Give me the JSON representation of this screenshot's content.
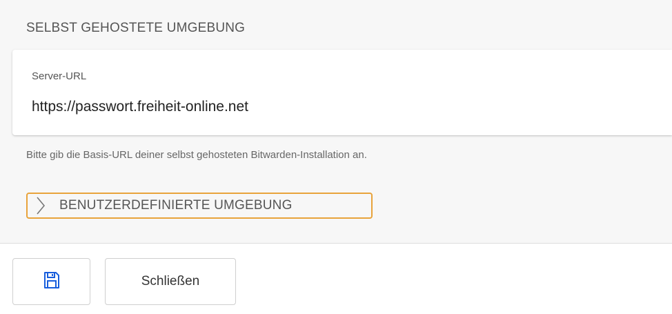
{
  "section": {
    "title": "SELBST GEHOSTETE UMGEBUNG"
  },
  "server_url": {
    "label": "Server-URL",
    "value": "https://passwort.freiheit-online.net"
  },
  "help_text": "Bitte gib die Basis-URL deiner selbst gehosteten Bitwarden-Installation an.",
  "custom_environment": {
    "label": "BENUTZERDEFINIERTE UMGEBUNG",
    "expanded": false,
    "icon": "chevron-right-icon"
  },
  "footer": {
    "save_icon": "save-icon",
    "close_label": "Schließen"
  },
  "colors": {
    "focus_outline": "#e8a33a",
    "save_icon": "#175ddc",
    "panel_background": "#f7f7f7"
  }
}
